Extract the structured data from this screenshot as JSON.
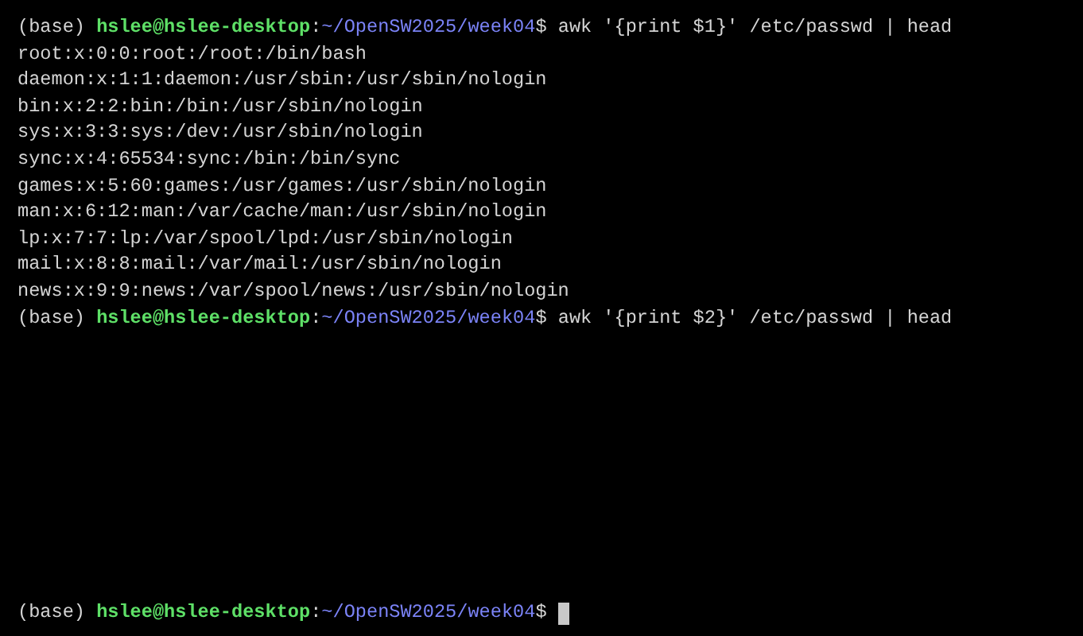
{
  "terminal": {
    "lines": [
      {
        "kind": "prompt",
        "env": "(base)",
        "user": "hslee@hslee-desktop",
        "sep": ":",
        "path": "~/OpenSW2025/week04",
        "symbol": "$",
        "command": "awk '{print $1}' /etc/passwd | head"
      },
      {
        "kind": "output",
        "text": "root:x:0:0:root:/root:/bin/bash"
      },
      {
        "kind": "output",
        "text": "daemon:x:1:1:daemon:/usr/sbin:/usr/sbin/nologin"
      },
      {
        "kind": "output",
        "text": "bin:x:2:2:bin:/bin:/usr/sbin/nologin"
      },
      {
        "kind": "output",
        "text": "sys:x:3:3:sys:/dev:/usr/sbin/nologin"
      },
      {
        "kind": "output",
        "text": "sync:x:4:65534:sync:/bin:/bin/sync"
      },
      {
        "kind": "output",
        "text": "games:x:5:60:games:/usr/games:/usr/sbin/nologin"
      },
      {
        "kind": "output",
        "text": "man:x:6:12:man:/var/cache/man:/usr/sbin/nologin"
      },
      {
        "kind": "output",
        "text": "lp:x:7:7:lp:/var/spool/lpd:/usr/sbin/nologin"
      },
      {
        "kind": "output",
        "text": "mail:x:8:8:mail:/var/mail:/usr/sbin/nologin"
      },
      {
        "kind": "output",
        "text": "news:x:9:9:news:/var/spool/news:/usr/sbin/nologin"
      },
      {
        "kind": "prompt",
        "env": "(base)",
        "user": "hslee@hslee-desktop",
        "sep": ":",
        "path": "~/OpenSW2025/week04",
        "symbol": "$",
        "command": "awk '{print $2}' /etc/passwd | head"
      }
    ],
    "active_prompt": {
      "env": "(base)",
      "user": "hslee@hslee-desktop",
      "sep": ":",
      "path": "~/OpenSW2025/week04",
      "symbol": "$",
      "cursor": true
    }
  }
}
